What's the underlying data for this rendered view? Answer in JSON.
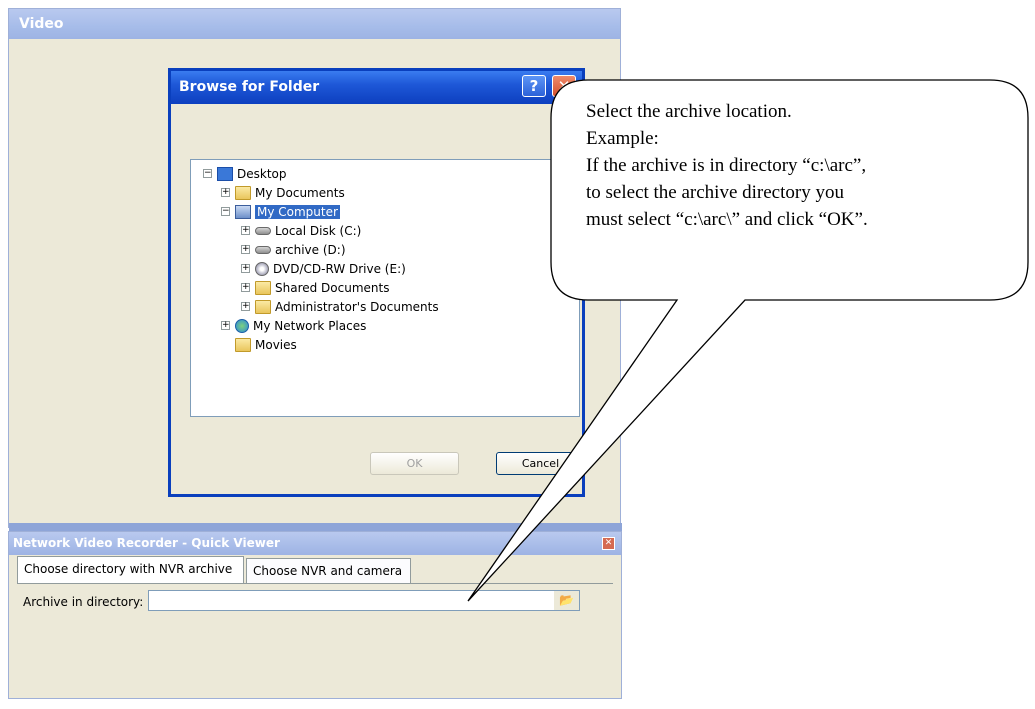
{
  "video_window": {
    "title": "Video"
  },
  "browse_dialog": {
    "title": "Browse for Folder",
    "help_label": "?",
    "close_label": "✕",
    "tree": [
      {
        "label": "Desktop",
        "icon": "desktop-icon",
        "expander": "−"
      },
      {
        "label": "My Documents",
        "icon": "folder-icon",
        "expander": "+"
      },
      {
        "label": "My Computer",
        "icon": "computer-icon",
        "expander": "−",
        "selected": true
      },
      {
        "label": "Local Disk (C:)",
        "icon": "disk-icon",
        "expander": "+"
      },
      {
        "label": "archive (D:)",
        "icon": "disk-icon",
        "expander": "+"
      },
      {
        "label": "DVD/CD-RW Drive (E:)",
        "icon": "dvd-icon",
        "expander": "+"
      },
      {
        "label": "Shared Documents",
        "icon": "folder-icon",
        "expander": "+"
      },
      {
        "label": "Administrator's Documents",
        "icon": "folder-icon",
        "expander": "+"
      },
      {
        "label": "My Network Places",
        "icon": "network-icon",
        "expander": "+"
      },
      {
        "label": "Movies",
        "icon": "folder-icon",
        "expander": ""
      }
    ],
    "ok_label": "OK",
    "cancel_label": "Cancel"
  },
  "quick_viewer": {
    "title": "Network Video Recorder - Quick Viewer",
    "close_label": "✕",
    "tabs": [
      {
        "label": "Choose directory with NVR archive"
      },
      {
        "label": "Choose NVR and camera"
      }
    ],
    "archive_label": "Archive in directory:",
    "archive_value": "",
    "browse_button_icon": "📂"
  },
  "callout": {
    "lines": [
      "Select the archive location.",
      "Example:",
      "If the archive is in directory “c:\\arc”,",
      "to select the archive directory you",
      "must select “c:\\arc\\” and click “OK”."
    ]
  }
}
